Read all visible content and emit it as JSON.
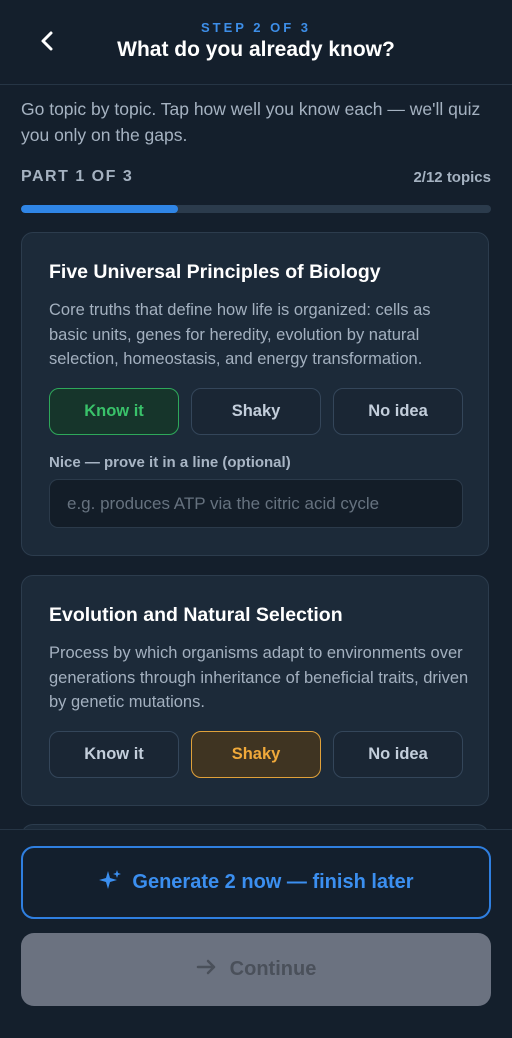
{
  "header": {
    "step": "STEP 2 OF 3",
    "title": "What do you already know?",
    "back_icon": "chevron-left-icon"
  },
  "intro": "Go topic by topic. Tap how well you know each — we'll quiz you only on the gaps.",
  "progress": {
    "part": "PART 1 OF 3",
    "count": "2/12 topics",
    "fraction": 0.333,
    "color": "#2f85e6"
  },
  "topics": [
    {
      "title": "Five Universal Principles of Biology",
      "description": "Core truths that define how life is organized: cells as basic units, genes for heredity, evolution by natural selection, homeostasis, and energy transformation.",
      "options": [
        "Know it",
        "Shaky",
        "No idea"
      ],
      "selected": "Know it",
      "proof_label": "Nice — prove it in a line (optional)",
      "proof_placeholder": "e.g. produces ATP via the citric acid cycle",
      "proof_value": ""
    },
    {
      "title": "Evolution and Natural Selection",
      "description": "Process by which organisms adapt to environments over generations through inheritance of beneficial traits, driven by genetic mutations.",
      "options": [
        "Know it",
        "Shaky",
        "No idea"
      ],
      "selected": "Shaky"
    }
  ],
  "footer": {
    "generate_label": "Generate 2 now — finish later",
    "generate_icon": "sparkles-icon",
    "continue_label": "Continue",
    "continue_icon": "arrow-right-icon",
    "accent": "#3b8ff0"
  }
}
